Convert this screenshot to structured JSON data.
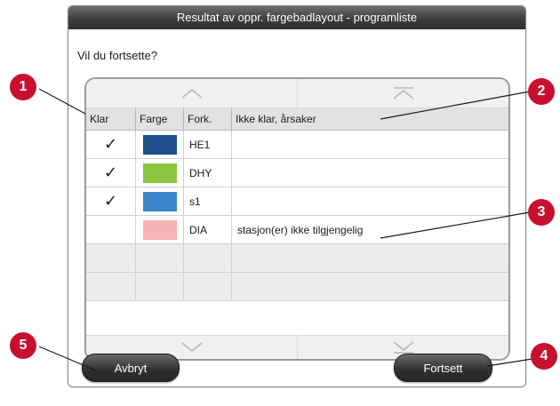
{
  "dialog": {
    "title": "Resultat av oppr. fargebadlayout - programliste",
    "question": "Vil du fortsette?"
  },
  "table": {
    "headers": [
      "Klar",
      "Farge",
      "Fork.",
      "Ikke klar, årsaker"
    ],
    "rows": [
      {
        "ready": "✓",
        "color": "#1f4e8c",
        "abbr": "HE1",
        "reason": ""
      },
      {
        "ready": "✓",
        "color": "#8cc63f",
        "abbr": "DHY",
        "reason": ""
      },
      {
        "ready": "✓",
        "color": "#3a86c8",
        "abbr": "s1",
        "reason": ""
      },
      {
        "ready": "",
        "color": "#f7b3b3",
        "abbr": "DIA",
        "reason": "stasjon(er) ikke tilgjengelig"
      }
    ],
    "empty_rows": 3,
    "scroll_icons": [
      "chevron-up-icon",
      "scroll-to-top-icon",
      "chevron-down-icon",
      "scroll-to-bottom-icon"
    ]
  },
  "buttons": {
    "cancel": "Avbryt",
    "continue": "Fortsett"
  },
  "callouts": [
    "1",
    "2",
    "3",
    "4",
    "5"
  ],
  "colors": {
    "callout": "#c8102e",
    "titlebar": "#3e3e3e",
    "button": "#2f2f2f"
  }
}
